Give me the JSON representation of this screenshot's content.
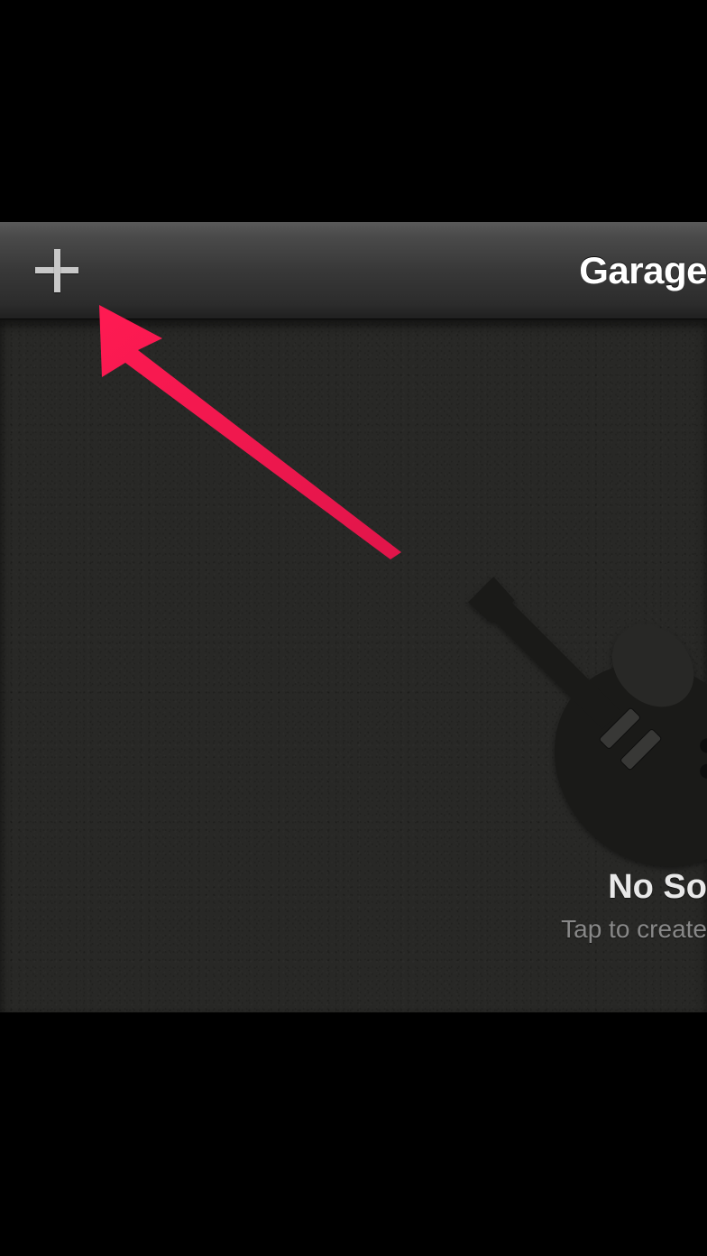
{
  "toolbar": {
    "title": "Garage"
  },
  "empty_state": {
    "title": "No So",
    "subtitle": "Tap to create"
  },
  "annotation": {
    "arrow_color": "#ff1a52"
  }
}
